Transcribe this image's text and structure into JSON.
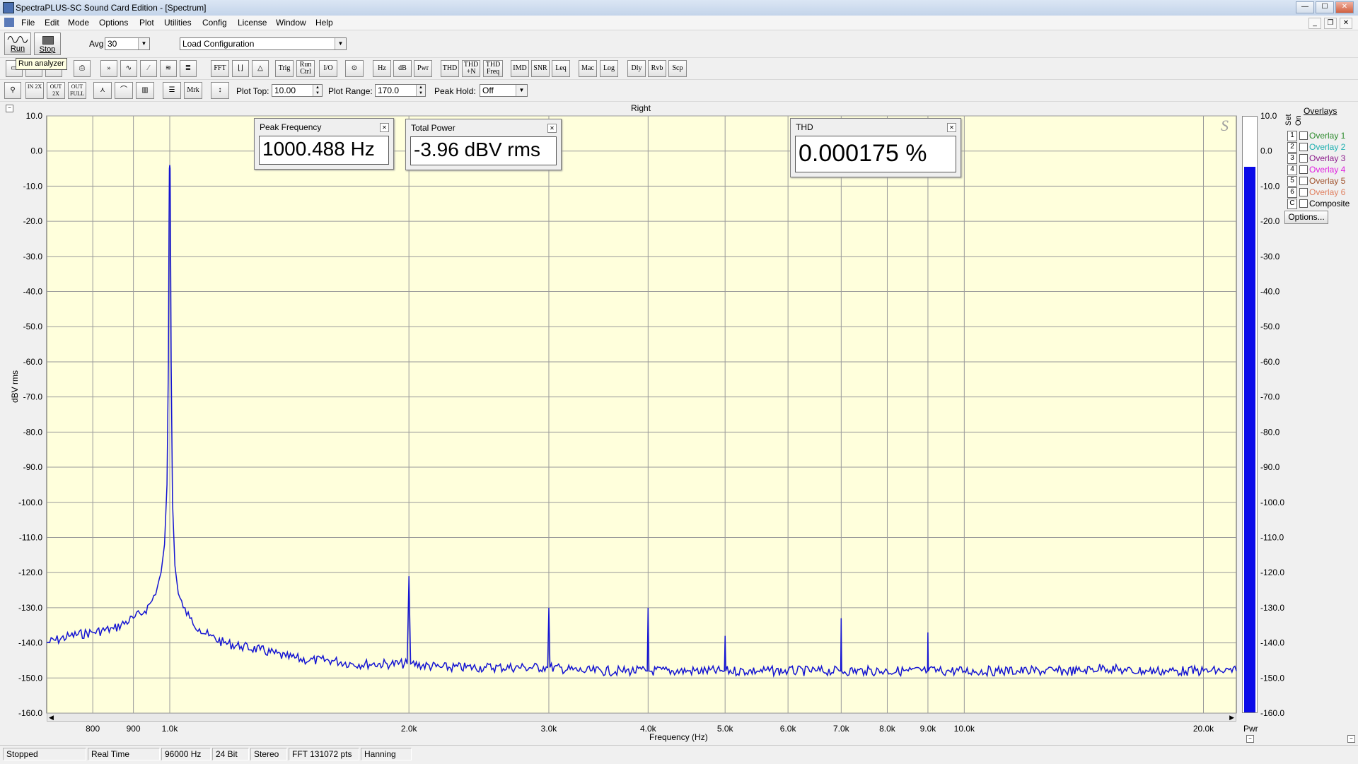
{
  "window": {
    "title": "SpectraPLUS-SC Sound Card Edition - [Spectrum]"
  },
  "menu": [
    "File",
    "Edit",
    "Mode",
    "Options",
    "Plot",
    "Utilities",
    "Config",
    "License",
    "Window",
    "Help"
  ],
  "toolbar1": {
    "run_label": "Run",
    "stop_label": "Stop",
    "avg_label": "Avg",
    "avg_value": "30",
    "config_value": "Load Configuration"
  },
  "tooltip": "Run analyzer",
  "toolbar2": [
    "FFT",
    "Trig",
    "Run Ctrl",
    "I/O",
    "Hz",
    "dB",
    "Pwr",
    "THD",
    "THD +N",
    "THD Freq",
    "IMD",
    "SNR",
    "Leq",
    "Mac",
    "Log",
    "Dly",
    "Rvb",
    "Scp"
  ],
  "toolbar3": {
    "zoom_buttons": [
      "IN 2X",
      "OUT 2X",
      "OUT FULL"
    ],
    "mrk_label": "Mrk",
    "plot_top_label": "Plot Top:",
    "plot_top_value": "10.00",
    "plot_range_label": "Plot Range:",
    "plot_range_value": "170.0",
    "peak_hold_label": "Peak Hold:",
    "peak_hold_value": "Off"
  },
  "readouts": {
    "peak_frequency": {
      "title": "Peak Frequency",
      "value": "1000.488 Hz"
    },
    "total_power": {
      "title": "Total Power",
      "value": "-3.96 dBV rms"
    },
    "thd": {
      "title": "THD",
      "value": "0.000175 %"
    }
  },
  "overlays": {
    "header": "Overlays",
    "set_label": "Set",
    "on_label": "On",
    "items": [
      {
        "num": "1",
        "label": "Overlay 1",
        "color": "#2e8b2e"
      },
      {
        "num": "2",
        "label": "Overlay 2",
        "color": "#1fb0b0"
      },
      {
        "num": "3",
        "label": "Overlay 3",
        "color": "#8b1a8b"
      },
      {
        "num": "4",
        "label": "Overlay 4",
        "color": "#e020e0"
      },
      {
        "num": "5",
        "label": "Overlay 5",
        "color": "#a0522d"
      },
      {
        "num": "6",
        "label": "Overlay 6",
        "color": "#e08060"
      },
      {
        "num": "C",
        "label": "Composite",
        "color": "#000000"
      }
    ],
    "options_label": "Options..."
  },
  "meter": {
    "label": "Pwr",
    "level_dbv": -3.96,
    "color": "#0a0ae8"
  },
  "status": [
    "Stopped",
    "Real Time",
    "96000 Hz",
    "24 Bit",
    "Stereo",
    "FFT 131072 pts",
    "Hanning"
  ],
  "chart_data": {
    "type": "line",
    "title": "Right",
    "xlabel": "Frequency (Hz)",
    "ylabel": "dBV rms",
    "x_scale": "log",
    "xlim": [
      700,
      22000
    ],
    "ylim": [
      -160,
      10
    ],
    "grid": true,
    "plot_background": "#ffffdc",
    "line_color": "#1414d2",
    "y_ticks": [
      10,
      0,
      -10,
      -20,
      -30,
      -40,
      -50,
      -60,
      -70,
      -80,
      -90,
      -100,
      -110,
      -120,
      -130,
      -140,
      -150,
      -160
    ],
    "y_tick_labels": [
      "10.0",
      "0.0",
      "-10.0",
      "-20.0",
      "-30.0",
      "-40.0",
      "-50.0",
      "-60.0",
      "-70.0",
      "-80.0",
      "-90.0",
      "-100.0",
      "-110.0",
      "-120.0",
      "-130.0",
      "-140.0",
      "-150.0",
      "-160.0"
    ],
    "x_ticks": [
      800,
      900,
      1000,
      2000,
      3000,
      4000,
      5000,
      6000,
      7000,
      8000,
      9000,
      10000,
      20000
    ],
    "x_tick_labels": [
      "800",
      "900",
      "1.0k",
      "2.0k",
      "3.0k",
      "4.0k",
      "5.0k",
      "6.0k",
      "7.0k",
      "8.0k",
      "9.0k",
      "10.0k",
      "20.0k"
    ],
    "series": [
      {
        "x": [
          700,
          750,
          800,
          850,
          900,
          930,
          950,
          965,
          975,
          985,
          992,
          996,
          998,
          999,
          1000,
          1001,
          1002,
          1004,
          1008,
          1015,
          1025,
          1040,
          1060,
          1090,
          1120,
          1170,
          1230,
          1300,
          1400,
          1500,
          1600,
          1700,
          1800,
          1900,
          1990,
          2000,
          2010,
          2200,
          2500,
          2800,
          2990,
          3000,
          3010,
          3300,
          3700,
          3990,
          4000,
          4010,
          4500,
          4990,
          5000,
          5010,
          5500,
          6000,
          6500,
          6990,
          7000,
          7010,
          7500,
          8000,
          8500,
          8990,
          9000,
          9010,
          9500,
          10000,
          11000,
          12000,
          13000,
          14000,
          15000,
          16000,
          17000,
          18000,
          19000,
          20000,
          21000,
          22000
        ],
        "y": [
          -140,
          -138,
          -137,
          -136,
          -133,
          -131,
          -128,
          -124,
          -120,
          -112,
          -95,
          -60,
          -20,
          -5,
          -3.96,
          -5,
          -20,
          -60,
          -100,
          -118,
          -126,
          -130,
          -133,
          -136,
          -138,
          -140,
          -141,
          -142,
          -144,
          -145,
          -145,
          -146,
          -146,
          -146,
          -146,
          -121,
          -146,
          -147,
          -147,
          -147,
          -147,
          -130,
          -147,
          -148,
          -148,
          -148,
          -130,
          -148,
          -148,
          -148,
          -138,
          -148,
          -148,
          -148,
          -148,
          -148,
          -133,
          -148,
          -148,
          -148,
          -148,
          -148,
          -137,
          -148,
          -148,
          -148,
          -148,
          -148,
          -148,
          -148,
          -147,
          -148,
          -148,
          -148,
          -148,
          -148,
          -148,
          -148
        ]
      }
    ]
  }
}
